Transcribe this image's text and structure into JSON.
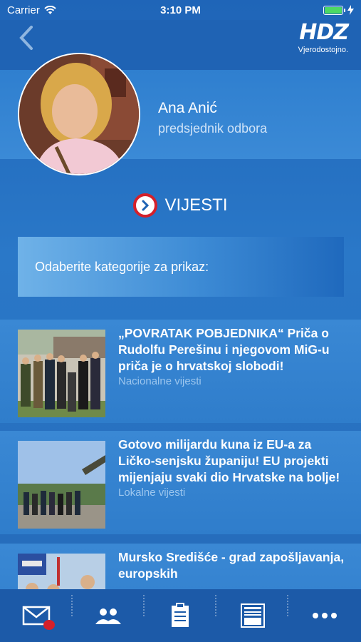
{
  "status_bar": {
    "carrier": "Carrier",
    "time": "3:10 PM"
  },
  "header": {
    "logo_text": "HDZ",
    "tagline": "Vjerodostojno."
  },
  "profile": {
    "name": "Ana Anić",
    "role": "predsjednik odbora"
  },
  "section": {
    "title": "VIJESTI"
  },
  "category_prompt": "Odaberite kategorije za prikaz:",
  "news": [
    {
      "title": "„POVRATAK POBJEDNIKA“ Priča o Rudolfu Perešinu i njegovom MiG-u priča je o hrvatskoj slobodi!",
      "category": "Nacionalne vijesti"
    },
    {
      "title": "Gotovo milijardu kuna iz EU-a za Ličko-senjsku županiju! EU projekti mijenjaju svaki dio Hrvatske na bolje!",
      "category": "Lokalne vijesti"
    },
    {
      "title": "Mursko Središće - grad zapošljavanja, europskih",
      "category": ""
    }
  ],
  "tabbar": {
    "items": [
      "mail-icon",
      "members-icon",
      "clipboard-icon",
      "newsletter-icon",
      "more-icon"
    ]
  },
  "colors": {
    "accent_red": "#d5202a",
    "brand_blue": "#1f63b4"
  }
}
